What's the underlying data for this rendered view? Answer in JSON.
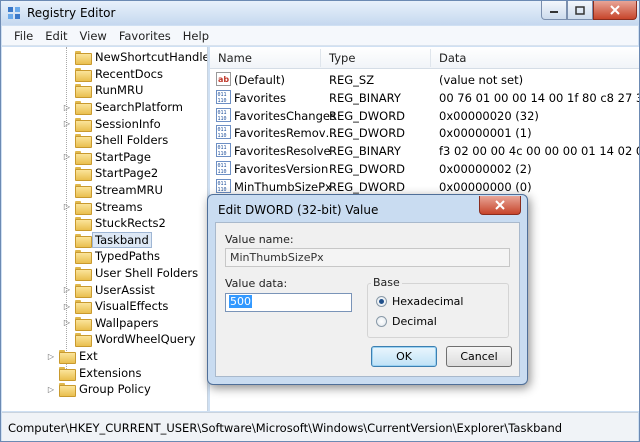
{
  "window": {
    "title": "Registry Editor"
  },
  "menu": [
    "File",
    "Edit",
    "View",
    "Favorites",
    "Help"
  ],
  "tree": [
    {
      "label": "NewShortcutHandle",
      "expander": ""
    },
    {
      "label": "RecentDocs",
      "expander": ""
    },
    {
      "label": "RunMRU",
      "expander": ""
    },
    {
      "label": "SearchPlatform",
      "expander": "▷"
    },
    {
      "label": "SessionInfo",
      "expander": "▷"
    },
    {
      "label": "Shell Folders",
      "expander": ""
    },
    {
      "label": "StartPage",
      "expander": "▷"
    },
    {
      "label": "StartPage2",
      "expander": ""
    },
    {
      "label": "StreamMRU",
      "expander": ""
    },
    {
      "label": "Streams",
      "expander": "▷"
    },
    {
      "label": "StuckRects2",
      "expander": ""
    },
    {
      "label": "Taskband",
      "expander": "",
      "selected": true
    },
    {
      "label": "TypedPaths",
      "expander": ""
    },
    {
      "label": "User Shell Folders",
      "expander": ""
    },
    {
      "label": "UserAssist",
      "expander": "▷"
    },
    {
      "label": "VisualEffects",
      "expander": "▷"
    },
    {
      "label": "Wallpapers",
      "expander": "▷"
    },
    {
      "label": "WordWheelQuery",
      "expander": ""
    },
    {
      "label": "Ext",
      "expander": "▷",
      "level": 0
    },
    {
      "label": "Extensions",
      "expander": "",
      "level": 0
    },
    {
      "label": "Group Policy",
      "expander": "▷",
      "level": 0
    }
  ],
  "list": {
    "columns": [
      "Name",
      "Type",
      "Data"
    ],
    "rows": [
      {
        "icon": "string-value-icon",
        "name": "(Default)",
        "type": "REG_SZ",
        "data": "(value not set)"
      },
      {
        "icon": "binary-value-icon",
        "name": "Favorites",
        "type": "REG_BINARY",
        "data": "00 76 01 00 00 14 00 1f 80 c8 27 34 1f 10 5"
      },
      {
        "icon": "binary-value-icon",
        "name": "FavoritesChanges",
        "type": "REG_DWORD",
        "data": "0x00000020 (32)"
      },
      {
        "icon": "binary-value-icon",
        "name": "FavoritesRemov…",
        "type": "REG_DWORD",
        "data": "0x00000001 (1)"
      },
      {
        "icon": "binary-value-icon",
        "name": "FavoritesResolve",
        "type": "REG_BINARY",
        "data": "f3 02 00 00 4c 00 00 00 01 14 02 00 00 00 0"
      },
      {
        "icon": "binary-value-icon",
        "name": "FavoritesVersion",
        "type": "REG_DWORD",
        "data": "0x00000002 (2)"
      },
      {
        "icon": "binary-value-icon",
        "name": "MinThumbSizePx",
        "type": "REG_DWORD",
        "data": "0x00000000 (0)"
      }
    ]
  },
  "status": {
    "path": "Computer\\HKEY_CURRENT_USER\\Software\\Microsoft\\Windows\\CurrentVersion\\Explorer\\Taskband"
  },
  "dialog": {
    "title": "Edit DWORD (32-bit) Value",
    "value_name_label": "Value name:",
    "value_name": "MinThumbSizePx",
    "value_data_label": "Value data:",
    "value_data": "500",
    "base_label": "Base",
    "hex_label": "Hexadecimal",
    "dec_label": "Decimal",
    "base_selected": "hexadecimal",
    "ok_label": "OK",
    "cancel_label": "Cancel"
  }
}
